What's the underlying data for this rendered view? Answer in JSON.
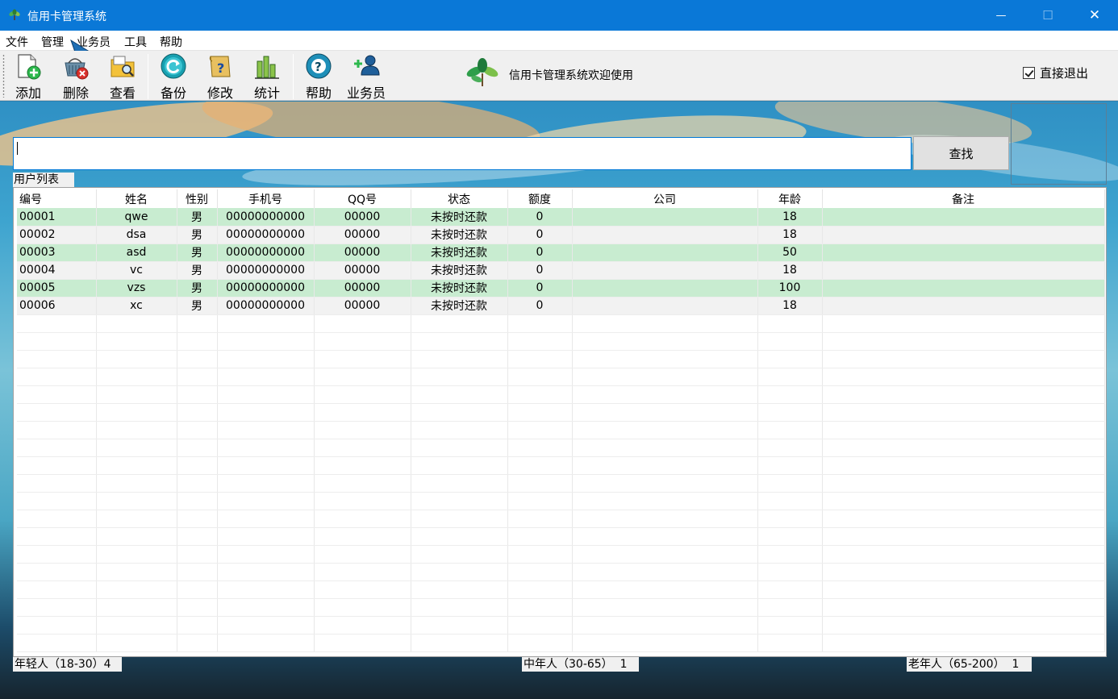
{
  "window": {
    "title": "信用卡管理系统",
    "minimize_glyph": "—",
    "maximize_glyph": "☐",
    "close_glyph": "✕"
  },
  "menu": [
    "文件",
    "管理",
    "业务员",
    "工具",
    "帮助"
  ],
  "toolbar": {
    "buttons": [
      {
        "label": "添加",
        "icon": "add-document-icon"
      },
      {
        "label": "删除",
        "icon": "delete-basket-icon"
      },
      {
        "label": "查看",
        "icon": "view-folder-icon"
      },
      {
        "label": "备份",
        "icon": "backup-refresh-icon"
      },
      {
        "label": "修改",
        "icon": "edit-question-icon"
      },
      {
        "label": "统计",
        "icon": "statistics-bars-icon"
      },
      {
        "label": "帮助",
        "icon": "help-icon"
      },
      {
        "label": "业务员",
        "icon": "add-user-icon"
      }
    ],
    "welcome": "信用卡管理系统欢迎使用",
    "direct_exit": {
      "label": "直接退出",
      "checked": true
    }
  },
  "search": {
    "value": "",
    "button": "查找"
  },
  "user_list": {
    "label": "用户列表",
    "columns": [
      "编号",
      "姓名",
      "性别",
      "手机号",
      "QQ号",
      "状态",
      "额度",
      "公司",
      "年龄",
      "备注"
    ],
    "rows": [
      [
        "00001",
        "qwe",
        "男",
        "00000000000",
        "00000",
        "未按时还款",
        "0",
        "",
        "18",
        ""
      ],
      [
        "00002",
        "dsa",
        "男",
        "00000000000",
        "00000",
        "未按时还款",
        "0",
        "",
        "18",
        ""
      ],
      [
        "00003",
        "asd",
        "男",
        "00000000000",
        "00000",
        "未按时还款",
        "0",
        "",
        "50",
        ""
      ],
      [
        "00004",
        "vc",
        "男",
        "00000000000",
        "00000",
        "未按时还款",
        "0",
        "",
        "18",
        ""
      ],
      [
        "00005",
        "vzs",
        "男",
        "00000000000",
        "00000",
        "未按时还款",
        "0",
        "",
        "100",
        ""
      ],
      [
        "00006",
        "xc",
        "男",
        "00000000000",
        "00000",
        "未按时还款",
        "0",
        "",
        "18",
        ""
      ]
    ]
  },
  "stats": {
    "young": "年轻人（18-30）4",
    "middle": "中年人（30-65）  1",
    "old": "老年人（65-200）  1"
  },
  "colors": {
    "titlebar": "#0a78d7",
    "row_highlight": "#c8ecd0",
    "row_alt": "#f2f2f2"
  }
}
